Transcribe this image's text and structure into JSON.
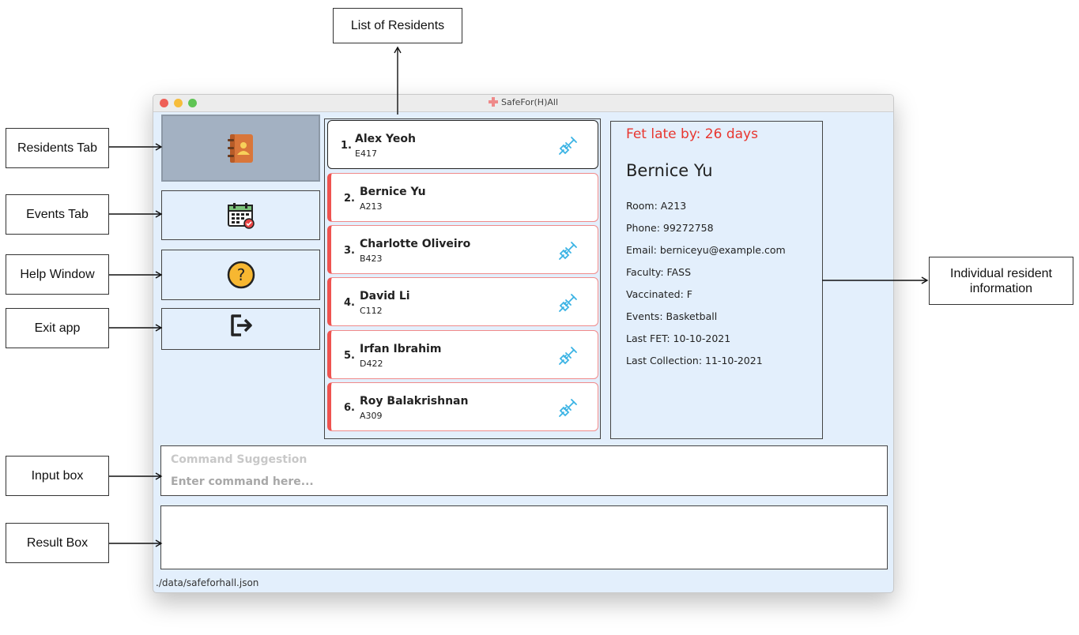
{
  "callouts": {
    "list_of_residents": "List of Residents",
    "residents_tab": "Residents Tab",
    "events_tab": "Events Tab",
    "help_window": "Help Window",
    "exit_app": "Exit app",
    "individual_info": "Individual resident information",
    "input_box": "Input box",
    "result_box": "Result Box"
  },
  "window": {
    "title": "SafeFor(H)All",
    "traffic_lights": [
      "#ee5f57",
      "#f6bd3b",
      "#5fc454"
    ]
  },
  "sidebar": {
    "tabs": [
      {
        "name": "residents",
        "icon": "address-book-icon",
        "active": true
      },
      {
        "name": "events",
        "icon": "calendar-icon",
        "active": false
      },
      {
        "name": "help",
        "icon": "help-icon",
        "active": false
      },
      {
        "name": "exit",
        "icon": "exit-icon",
        "active": false
      }
    ]
  },
  "residents": [
    {
      "index": "1.",
      "name": "Alex Yeoh",
      "room": "E417",
      "vaccinated": true,
      "late": false
    },
    {
      "index": "2.",
      "name": "Bernice Yu",
      "room": "A213",
      "vaccinated": false,
      "late": true
    },
    {
      "index": "3.",
      "name": "Charlotte Oliveiro",
      "room": "B423",
      "vaccinated": true,
      "late": true
    },
    {
      "index": "4.",
      "name": "David Li",
      "room": "C112",
      "vaccinated": true,
      "late": true
    },
    {
      "index": "5.",
      "name": "Irfan Ibrahim",
      "room": "D422",
      "vaccinated": true,
      "late": true
    },
    {
      "index": "6.",
      "name": "Roy Balakrishnan",
      "room": "A309",
      "vaccinated": true,
      "late": true
    }
  ],
  "detail": {
    "fet_late": "Fet late by: 26 days",
    "name": "Bernice Yu",
    "room": "Room: A213",
    "phone": "Phone: 99272758",
    "email": "Email: berniceyu@example.com",
    "faculty": "Faculty: FASS",
    "vaccinated": "Vaccinated: F",
    "events": "Events: Basketball",
    "last_fet": "Last FET: 10-10-2021",
    "last_collection": "Last Collection: 11-10-2021"
  },
  "command": {
    "suggestion": "Command Suggestion",
    "placeholder": "Enter command here...",
    "value": ""
  },
  "result": {
    "text": ""
  },
  "status_bar": {
    "path": "./data/safeforhall.json"
  },
  "colors": {
    "accent_late": "#e8362f",
    "window_bg": "#e3effc",
    "active_tab": "#a3b1c2",
    "syringe": "#3bb3e4"
  }
}
